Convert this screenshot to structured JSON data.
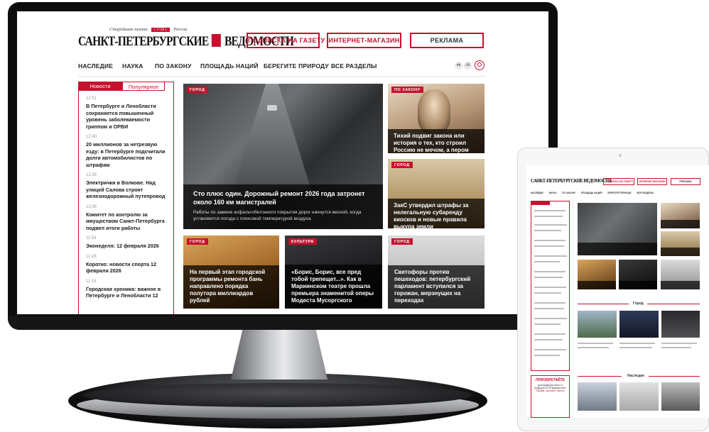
{
  "site": {
    "logo_tagline_left": "Старейшая газета",
    "logo_year": "с 1728 г.",
    "logo_tagline_right": "России",
    "logo_name_left": "САНКТ-ПЕТЕРБУРГСКИЕ",
    "logo_name_right": "ВЕДОМОСТИ"
  },
  "header_buttons": {
    "subscribe": "ПОДПИСКА НА ГАЗЕТУ",
    "shop": "ИНТЕРНЕТ-МАГАЗИН",
    "ads": "РЕКЛАМА"
  },
  "nav": {
    "items": [
      "НАСЛЕДИЕ",
      "НАУКА",
      "ПО ЗАКОНУ",
      "ПЛОЩАДЬ НАЦИЙ",
      "БЕРЕГИТЕ ПРИРОДУ",
      "ВСЕ РАЗДЕЛЫ"
    ],
    "vk_label": "vk",
    "ok_label": "ok",
    "search_icon": "search-icon"
  },
  "sidebar": {
    "tab_news": "Новости",
    "tab_popular": "Популярное",
    "feed": [
      {
        "time": "12:51",
        "title": "В Петербурге и Ленобласти сохраняется повышенный уровень заболеваемости гриппом и ОРВИ"
      },
      {
        "time": "12:40",
        "title": "20 миллионов за нетрезвую езду: в Петербурге подсчитали долги автомобилистов по штрафам"
      },
      {
        "time": "12:28",
        "title": "Электрички в Волкове. Над улицей Салова строят железнодорожный путепровод"
      },
      {
        "time": "12:06",
        "title": "Комитет по контролю за имуществом Санкт-Петербурга подвел итоги работы"
      },
      {
        "time": "11:54",
        "title": "Эконеделя: 12 февраля 2026"
      },
      {
        "time": "11:28",
        "title": "Коротко: новости спорта 12 февраля 2026"
      },
      {
        "time": "11:16",
        "title": "Городская хроника: важное в Петербурге и Ленобласти 12"
      }
    ]
  },
  "cards": {
    "main": {
      "tag": "ГОРОД",
      "title": "Сто плюс один. Дорожный ремонт 2026 года затронет около 160 км магистралей",
      "lead": "Работы по замене асфальтобетонного покрытия дорог начнутся весной, когда установится погода с плюсовой температурой воздуха."
    },
    "law": {
      "tag": "ПО ЗАКОНУ",
      "title": "Тихий подвиг закона или история о тех, кто строил Россию не мечом, а пером"
    },
    "city2": {
      "tag": "ГОРОД",
      "title": "ЗакС утвердил штрафы за нелегальную субаренду киосков и новые правила выкупа земли"
    },
    "sauna": {
      "tag": "ГОРОД",
      "title": "На первый этап городской программы ремонта бань направлено порядка полутора миллиардов рублей"
    },
    "culture": {
      "tag": "КУЛЬТУРА",
      "title": "«Борис, Борис, все пред тобой трепещет...». Как в Мариинском театре прошла премьера знаменитой оперы Модеста Мусоргского"
    },
    "lights": {
      "tag": "ГОРОД",
      "title": "Светофоры против пешеходов: петербургский парламент вступился за горожан, мерзнущих на переходах"
    }
  },
  "tablet": {
    "logo": "САНКТ-ПЕТЕРБУРГСКИЕ ВЕДОМОСТИ",
    "btn_subscribe": "ПОДПИСКА НА ГАЗЕТУ",
    "btn_shop": "ИНТЕРНЕТ-МАГАЗИН",
    "btn_ads": "РЕКЛАМА",
    "nav": [
      "НАСЛЕДИЕ",
      "НАУКА",
      "ПО ЗАКОНУ",
      "ПЛОЩАДЬ НАЦИЙ",
      "БЕРЕГИТЕ ПРИРОДУ",
      "ВСЕ РАЗДЕЛЫ"
    ],
    "section_city": "Город",
    "section_heritage": "Наследие",
    "promo_title": "ПРИОБРЕТАЙТЕ",
    "promo_text": "долгожданную книгу от редакции «СПб ведомостей»",
    "promo_red": "«Прайм: хорошего текста»"
  },
  "colors": {
    "accent": "#c8102e",
    "text": "#1a1a1a",
    "muted": "#9a9a9a"
  }
}
